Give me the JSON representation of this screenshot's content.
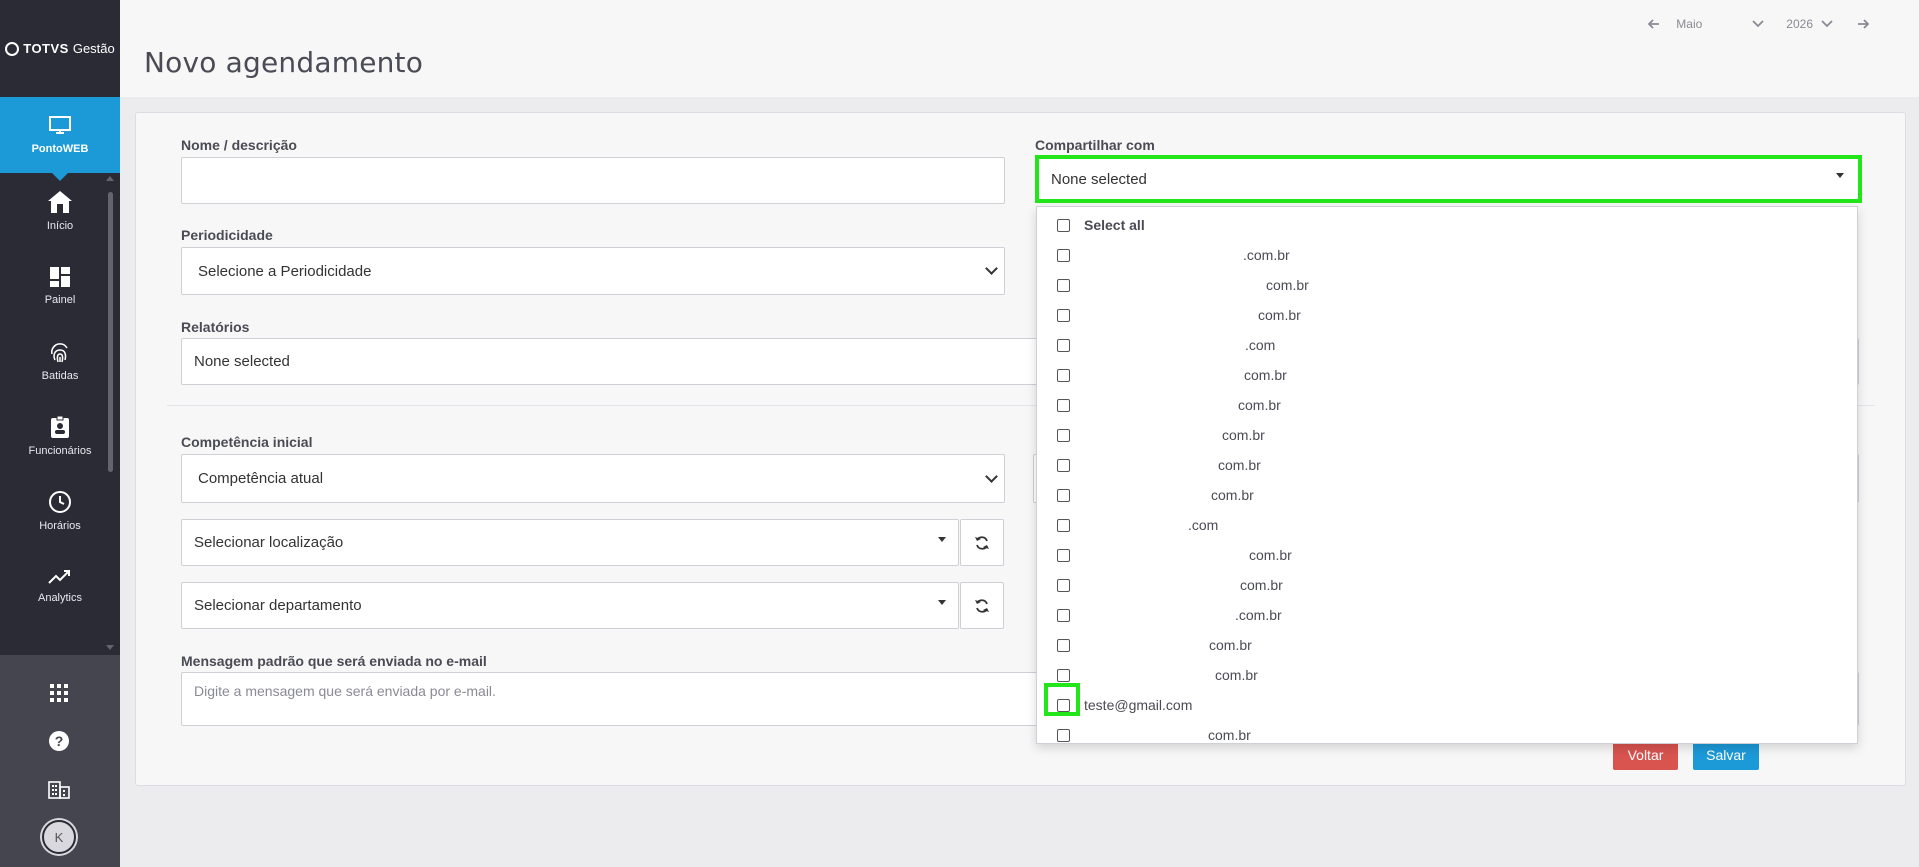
{
  "brand": {
    "name": "TOTVS",
    "suffix": "Gestão"
  },
  "module": {
    "label": "PontoWEB",
    "icon": "monitor-icon"
  },
  "nav": [
    {
      "label": "Início",
      "icon": "home-icon"
    },
    {
      "label": "Painel",
      "icon": "dashboard-icon"
    },
    {
      "label": "Batidas",
      "icon": "fingerprint-icon"
    },
    {
      "label": "Funcionários",
      "icon": "badge-icon"
    },
    {
      "label": "Horários",
      "icon": "clock-icon"
    },
    {
      "label": "Analytics",
      "icon": "trend-icon"
    }
  ],
  "header": {
    "title": "Novo agendamento",
    "month": "Maio",
    "year": "2026"
  },
  "form": {
    "nome_label": "Nome / descrição",
    "nome_value": "",
    "periodicidade_label": "Periodicidade",
    "periodicidade_value": "Selecione a Periodicidade",
    "relatorios_label": "Relatórios",
    "relatorios_value": "None selected",
    "competencia_label": "Competência inicial",
    "competencia_value": "Competência atual",
    "localizacao_value": "Selecionar localização",
    "departamento_value": "Selecionar departamento",
    "mensagem_label": "Mensagem padrão que será enviada no e-mail",
    "mensagem_placeholder": "Digite a mensagem que será enviada por e-mail.",
    "compartilhar_label": "Compartilhar com",
    "compartilhar_value": "None selected"
  },
  "dropdown": {
    "select_all": "Select all",
    "options": [
      ".com.br",
      "com.br",
      "com.br",
      ".com",
      "com.br",
      "com.br",
      "com.br",
      "com.br",
      "com.br",
      ".com",
      "com.br",
      "com.br",
      ".com.br",
      "com.br",
      "com.br",
      "teste@gmail.com",
      "com.br"
    ]
  },
  "buttons": {
    "back": "Voltar",
    "save": "Salvar"
  },
  "colors": {
    "sidebar": "#2b2b35",
    "accent": "#1c9ad8",
    "danger": "#d9534f",
    "highlight": "#22e61a"
  }
}
